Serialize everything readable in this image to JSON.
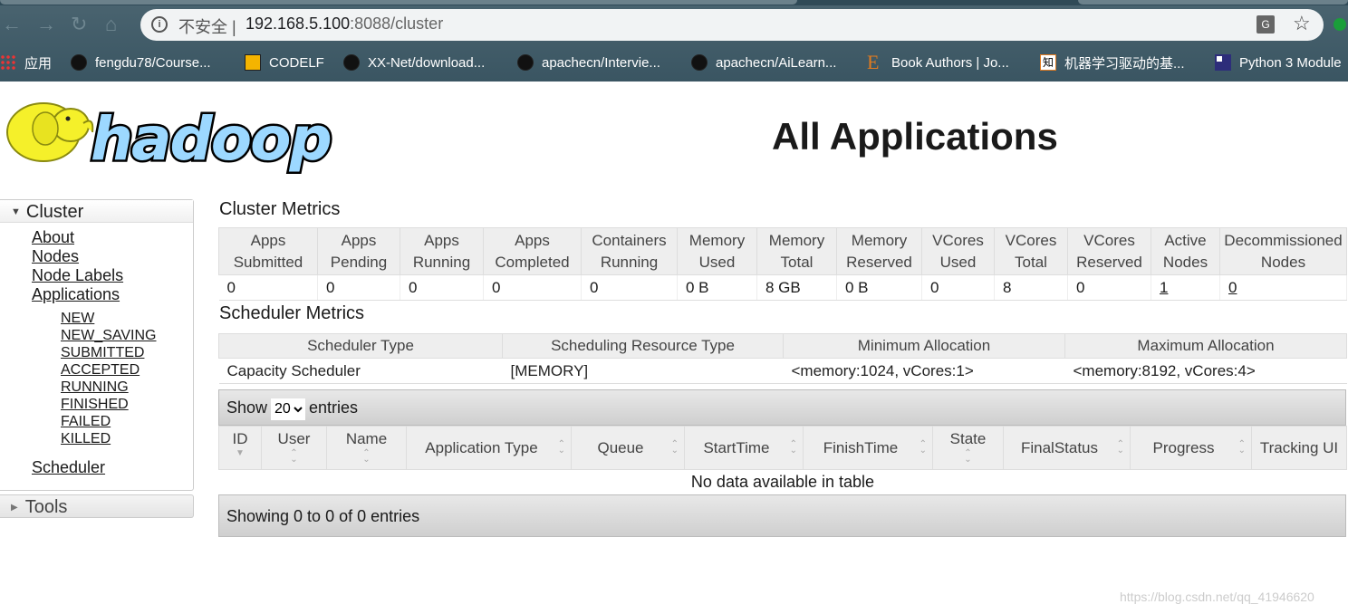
{
  "browser": {
    "insecure_label": "不安全",
    "url_host": "192.168.5.100",
    "url_rest": ":8088/cluster",
    "bookmarks": [
      {
        "label": "应用",
        "icon": "apps-grid-icon"
      },
      {
        "label": "fengdu78/Course...",
        "icon": "github-icon"
      },
      {
        "label": "CODELF",
        "icon": "codelf-icon"
      },
      {
        "label": "XX-Net/download...",
        "icon": "github-icon"
      },
      {
        "label": "apachecn/Intervie...",
        "icon": "github-icon"
      },
      {
        "label": "apachecn/AiLearn...",
        "icon": "github-icon"
      },
      {
        "label": "Book Authors | Jo...",
        "icon": "e-icon"
      },
      {
        "label": "机器学习驱动的基...",
        "icon": "zhihu-icon"
      },
      {
        "label": "Python 3 Module",
        "icon": "python-module-icon"
      }
    ]
  },
  "logo_text": "hadoop",
  "page_title": "All Applications",
  "sidebar": {
    "cluster": "Cluster",
    "links": [
      "About",
      "Nodes",
      "Node Labels",
      "Applications"
    ],
    "states": [
      "NEW",
      "NEW_SAVING",
      "SUBMITTED",
      "ACCEPTED",
      "RUNNING",
      "FINISHED",
      "FAILED",
      "KILLED"
    ],
    "scheduler": "Scheduler",
    "tools": "Tools"
  },
  "cluster_metrics": {
    "title": "Cluster Metrics",
    "headers": [
      [
        "Apps",
        "Submitted"
      ],
      [
        "Apps",
        "Pending"
      ],
      [
        "Apps",
        "Running"
      ],
      [
        "Apps",
        "Completed"
      ],
      [
        "Containers",
        "Running"
      ],
      [
        "Memory",
        "Used"
      ],
      [
        "Memory",
        "Total"
      ],
      [
        "Memory",
        "Reserved"
      ],
      [
        "VCores",
        "Used"
      ],
      [
        "VCores",
        "Total"
      ],
      [
        "VCores",
        "Reserved"
      ],
      [
        "Active",
        "Nodes"
      ],
      [
        "Decommissioned",
        "Nodes"
      ]
    ],
    "values": [
      "0",
      "0",
      "0",
      "0",
      "0",
      "0 B",
      "8 GB",
      "0 B",
      "0",
      "8",
      "0",
      "1",
      "0"
    ]
  },
  "scheduler_metrics": {
    "title": "Scheduler Metrics",
    "headers": [
      "Scheduler Type",
      "Scheduling Resource Type",
      "Minimum Allocation",
      "Maximum Allocation"
    ],
    "values": [
      "Capacity Scheduler",
      "[MEMORY]",
      "<memory:1024, vCores:1>",
      "<memory:8192, vCores:4>"
    ]
  },
  "apps_table": {
    "show": "Show",
    "page_size": "20",
    "entries": "entries",
    "headers": [
      "ID",
      "User",
      "Name",
      "Application Type",
      "Queue",
      "StartTime",
      "FinishTime",
      "State",
      "FinalStatus",
      "Progress",
      "Tracking UI"
    ],
    "empty": "No data available in table",
    "info": "Showing 0 to 0 of 0 entries"
  },
  "watermark": "https://blog.csdn.net/qq_41946620"
}
